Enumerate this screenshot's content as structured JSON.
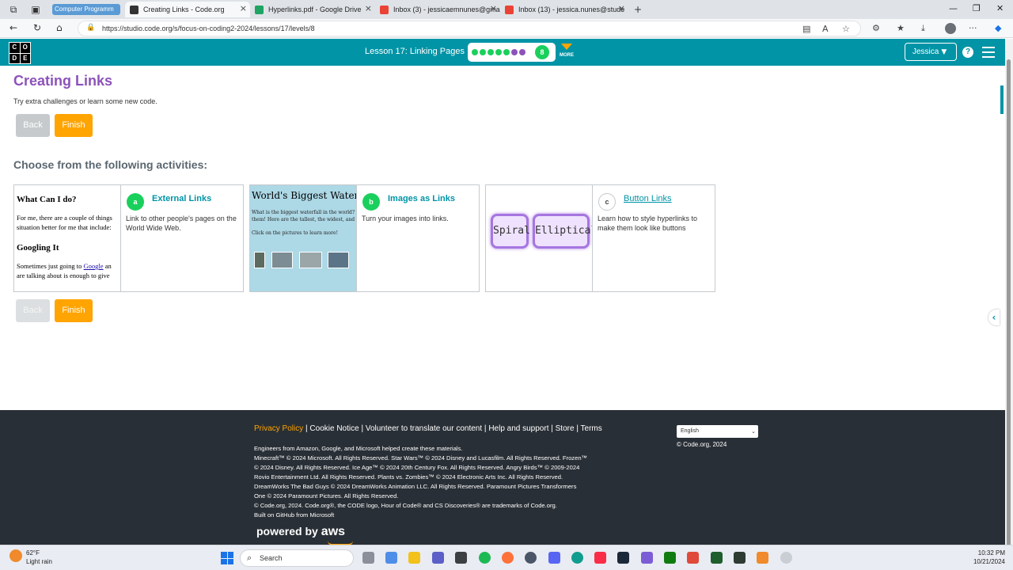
{
  "browser": {
    "tab_group": "Computer Programm",
    "tabs": [
      {
        "title": "Creating Links - Code.org",
        "active": true
      },
      {
        "title": "Hyperlinks.pdf - Google Drive",
        "active": false
      },
      {
        "title": "Inbox (3) - jessicaemnunes@gma",
        "active": false
      },
      {
        "title": "Inbox (13) - jessica.nunes@stude",
        "active": false
      }
    ],
    "url": "https://studio.code.org/s/focus-on-coding2-2024/lessons/17/levels/8"
  },
  "header": {
    "logo": [
      "C",
      "O",
      "D",
      "E"
    ],
    "lesson_title": "Lesson 17: Linking Pages",
    "current_level": "8",
    "more_label": "MORE",
    "user_name": "Jessica",
    "help": "?"
  },
  "main": {
    "title": "Creating Links",
    "subtitle": "Try extra challenges or learn some new code.",
    "back_label": "Back",
    "finish_label": "Finish",
    "choose_heading": "Choose from the following activities:",
    "activities": [
      {
        "letter": "a",
        "title": "External Links",
        "description": "Link to other people's pages on the World Wide Web.",
        "thumb_heading": "What Can I do?",
        "thumb_text1": "For me, there are a couple of things",
        "thumb_text2": "situation better for me that include:",
        "thumb_heading2": "Googling It",
        "thumb_text3a": "Sometimes just going to ",
        "thumb_link": "Google",
        "thumb_text3b": " an",
        "thumb_text4": "are talking about is enough to give"
      },
      {
        "letter": "b",
        "title": "Images as Links",
        "description": "Turn your images into links.",
        "thumb_heading": "World's Biggest Waterfall",
        "thumb_text1": "What is the biggest waterfall in the world? It depen",
        "thumb_text2": "them! Here are the tallest, the widest, and the large",
        "thumb_text3": "Click on the pictures to learn more!"
      },
      {
        "letter": "c",
        "title": "Button Links",
        "description": "Learn how to style hyperlinks to make them look like buttons",
        "thumb_button1": "Spiral",
        "thumb_button2": "Elliptical"
      }
    ]
  },
  "footer": {
    "links": {
      "privacy": "Privacy Policy",
      "cookie": "Cookie Notice",
      "volunteer": "Volunteer to translate our content",
      "help": "Help and support",
      "store": "Store",
      "terms": "Terms"
    },
    "separator": " | ",
    "legal_lines": [
      "Engineers from Amazon, Google, and Microsoft helped create these materials.",
      "Minecraft™ © 2024 Microsoft. All Rights Reserved. Star Wars™ © 2024 Disney and Lucasfilm. All Rights Reserved. Frozen™",
      "© 2024 Disney. All Rights Reserved. Ice Age™ © 2024 20th Century Fox. All Rights Reserved. Angry Birds™ © 2009-2024",
      "Rovio Entertainment Ltd. All Rights Reserved. Plants vs. Zombies™ © 2024 Electronic Arts Inc. All Rights Reserved.",
      "DreamWorks The Bad Guys © 2024 DreamWorks Animation LLC. All Rights Reserved. Paramount Pictures Transformers",
      "One © 2024 Paramount Pictures. All Rights Reserved.",
      "© Code.org, 2024. Code.org®, the CODE logo, Hour of Code® and CS Discoveries® are trademarks of Code.org.",
      "Built on GitHub from Microsoft"
    ],
    "language": "English",
    "copyright": "© Code.org, 2024",
    "powered_by": "powered by",
    "aws": "aws"
  },
  "taskbar": {
    "temperature": "62°F",
    "weather": "Light rain",
    "search": "Search",
    "time": "10:32 PM",
    "date": "10/21/2024"
  },
  "colors": {
    "header_teal": "#0094a6",
    "title_purple": "#8c52ba",
    "finish_orange": "#ffa400",
    "bubble_green": "#1ad05c",
    "footer_bg": "#292f36"
  }
}
